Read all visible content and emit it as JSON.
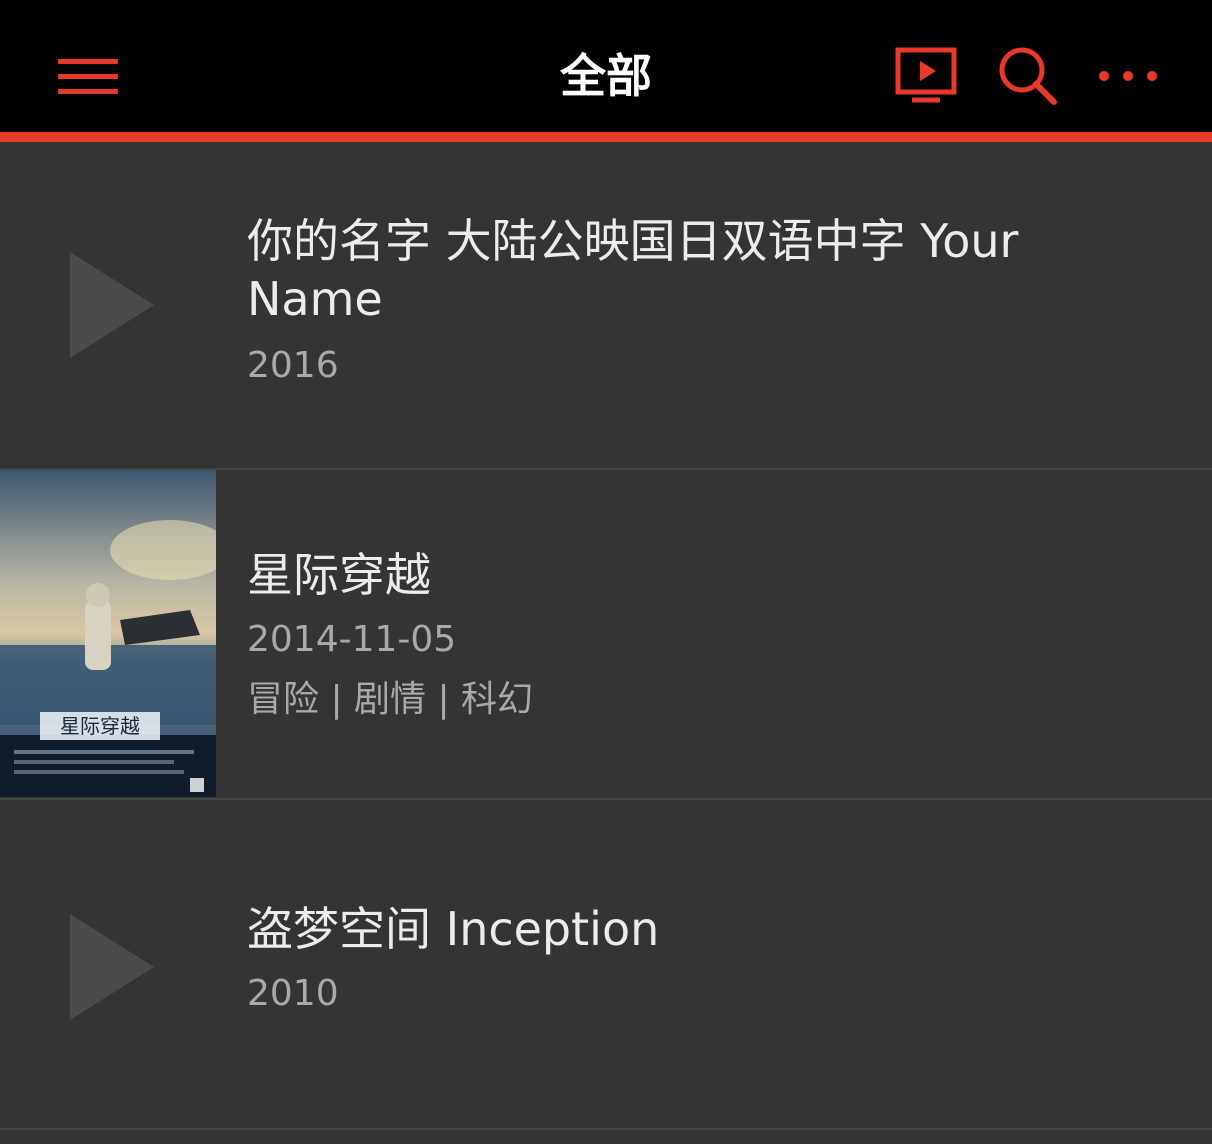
{
  "header": {
    "title": "全部",
    "menu_icon": "hamburger-menu-icon",
    "actions": [
      {
        "name": "player-icon"
      },
      {
        "name": "search-icon"
      },
      {
        "name": "more-icon"
      }
    ],
    "accent_color": "#e8392b",
    "background_color": "#000000"
  },
  "items": [
    {
      "title": "你的名字 大陆公映国日双语中字 Your Name",
      "year": "2016",
      "thumbnail": "play-placeholder-icon"
    },
    {
      "title": "星际穿越",
      "date": "2014-11-05",
      "genres": "冒险 | 剧情 | 科幻",
      "thumbnail": "movie-poster-image",
      "poster_text": "星际穿越"
    },
    {
      "title": "盗梦空间 Inception",
      "year": "2010",
      "thumbnail": "play-placeholder-icon"
    }
  ]
}
